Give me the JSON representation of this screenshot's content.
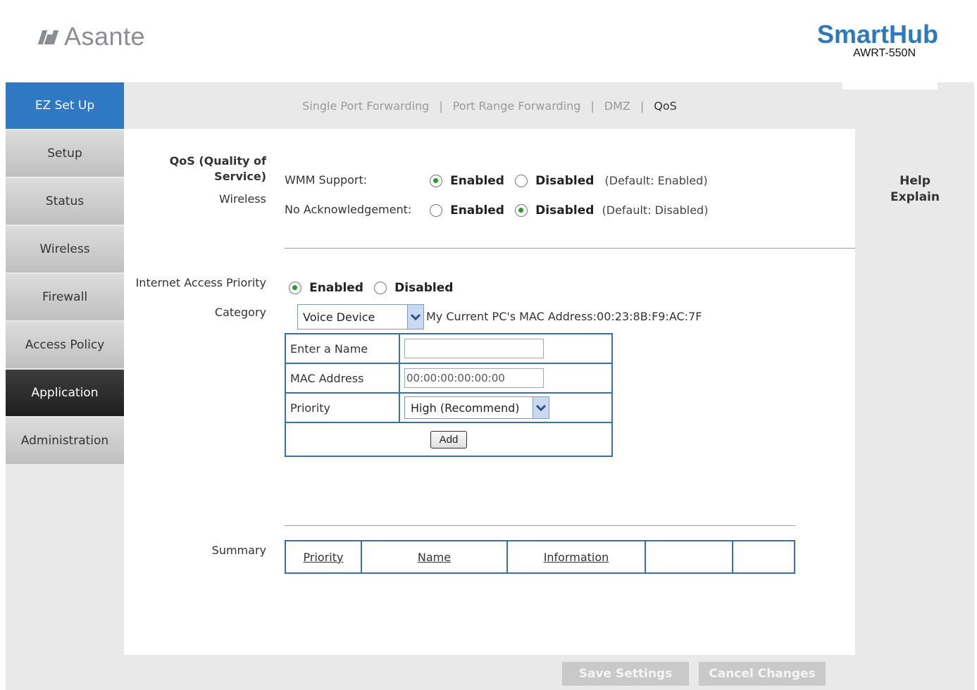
{
  "header": {
    "brand": "Asante",
    "product": "SmartHub",
    "model": "AWRT-550N"
  },
  "sidebar": {
    "items": [
      {
        "label": "EZ Set Up"
      },
      {
        "label": "Setup"
      },
      {
        "label": "Status"
      },
      {
        "label": "Wireless"
      },
      {
        "label": "Firewall"
      },
      {
        "label": "Access Policy"
      },
      {
        "label": "Application"
      },
      {
        "label": "Administration"
      }
    ],
    "active": "Application"
  },
  "subnav": {
    "items": [
      "Single Port Forwarding",
      "Port Range Forwarding",
      "DMZ",
      "QoS"
    ],
    "separator": "|",
    "current": "QoS"
  },
  "qos": {
    "section_title": "QoS (Quality of Service)",
    "wireless_label": "Wireless",
    "wmm_label": "WMM Support:",
    "noack_label": "No Acknowledgement:",
    "enabled": "Enabled",
    "disabled": "Disabled",
    "wmm_default": "(Default: Enabled)",
    "noack_default": "(Default: Disabled)",
    "wmm_value": "Enabled",
    "noack_value": "Disabled"
  },
  "priority": {
    "label": "Internet Access Priority",
    "enabled": "Enabled",
    "disabled": "Disabled",
    "value": "Enabled",
    "category_label": "Category",
    "category_value": "Voice Device",
    "mac_info": "My Current PC's MAC Address:00:23:8B:F9:AC:7F",
    "name_label": "Enter a Name",
    "name_value": "",
    "mac_label": "MAC Address",
    "mac_value": "00:00:00:00:00:00",
    "priority_label": "Priority",
    "priority_value": "High (Recommend)",
    "add_button": "Add"
  },
  "summary": {
    "label": "Summary",
    "columns": [
      "Priority",
      "Name",
      "Information",
      "",
      ""
    ]
  },
  "help": {
    "line1": "Help",
    "line2": "Explain"
  },
  "actions": {
    "save": "Save Settings",
    "cancel": "Cancel Changes"
  },
  "colors": {
    "accent": "#2f78c3",
    "brand_blue": "#2e78bd",
    "table_border": "#3a6fb0",
    "frame_gray": "#e9e9e9"
  }
}
